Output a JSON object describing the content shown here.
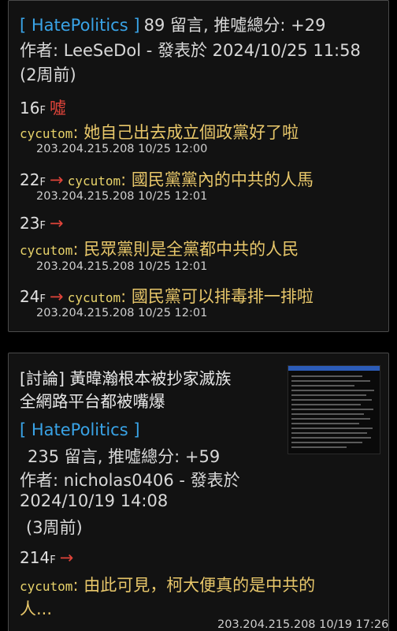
{
  "post1": {
    "board": "[ HatePolitics ]",
    "stats": "89 留言, 推噓總分: +29",
    "author": "作者: LeeSeDol - 發表於 2024/10/25 11:58",
    "age": "(2周前)",
    "comments": [
      {
        "floor": "16",
        "floor_suffix": "F",
        "tag": "噓",
        "user": "cycutom",
        "text": ": 她自己出去成立個政黨好了啦",
        "ip": "203.204.215.208 10/25 12:00"
      },
      {
        "floor": "22",
        "floor_suffix": "F",
        "tag": "→",
        "user": "cycutom",
        "text": ": 國民黨黨內的中共的人馬",
        "ip": "203.204.215.208 10/25 12:01"
      },
      {
        "floor": "23",
        "floor_suffix": "F",
        "tag": "→",
        "user": "cycutom",
        "text": ": 民眾黨則是全黨都中共的人民",
        "ip": "203.204.215.208 10/25 12:01"
      },
      {
        "floor": "24",
        "floor_suffix": "F",
        "tag": "→",
        "user": "cycutom",
        "text": ": 國民黨可以排毒排一排啦",
        "ip": "203.204.215.208 10/25 12:01"
      }
    ]
  },
  "post2": {
    "title_line1": "[討論] 黃暐瀚根本被抄家滅族",
    "title_line2": "全網路平台都被嘴爆",
    "board": "[ HatePolitics ]",
    "stats": "235 留言, 推噓總分: +59",
    "author_line1": "作者: nicholas0406 - 發表於",
    "author_line2": "2024/10/19 14:08",
    "age": "(3周前)",
    "comment": {
      "floor": "214",
      "floor_suffix": "F",
      "tag": "→",
      "user": "cycutom",
      "text_line1": ": 由此可見，柯大便真的是中共的",
      "text_line2": "人...",
      "ip": "203.204.215.208 10/19 17:26"
    }
  },
  "colors": {
    "board": "#39a3e6",
    "boo": "#e0443a",
    "user": "#e8d36a",
    "message": "#e8c76a",
    "background": "#000000",
    "card": "#121212"
  }
}
